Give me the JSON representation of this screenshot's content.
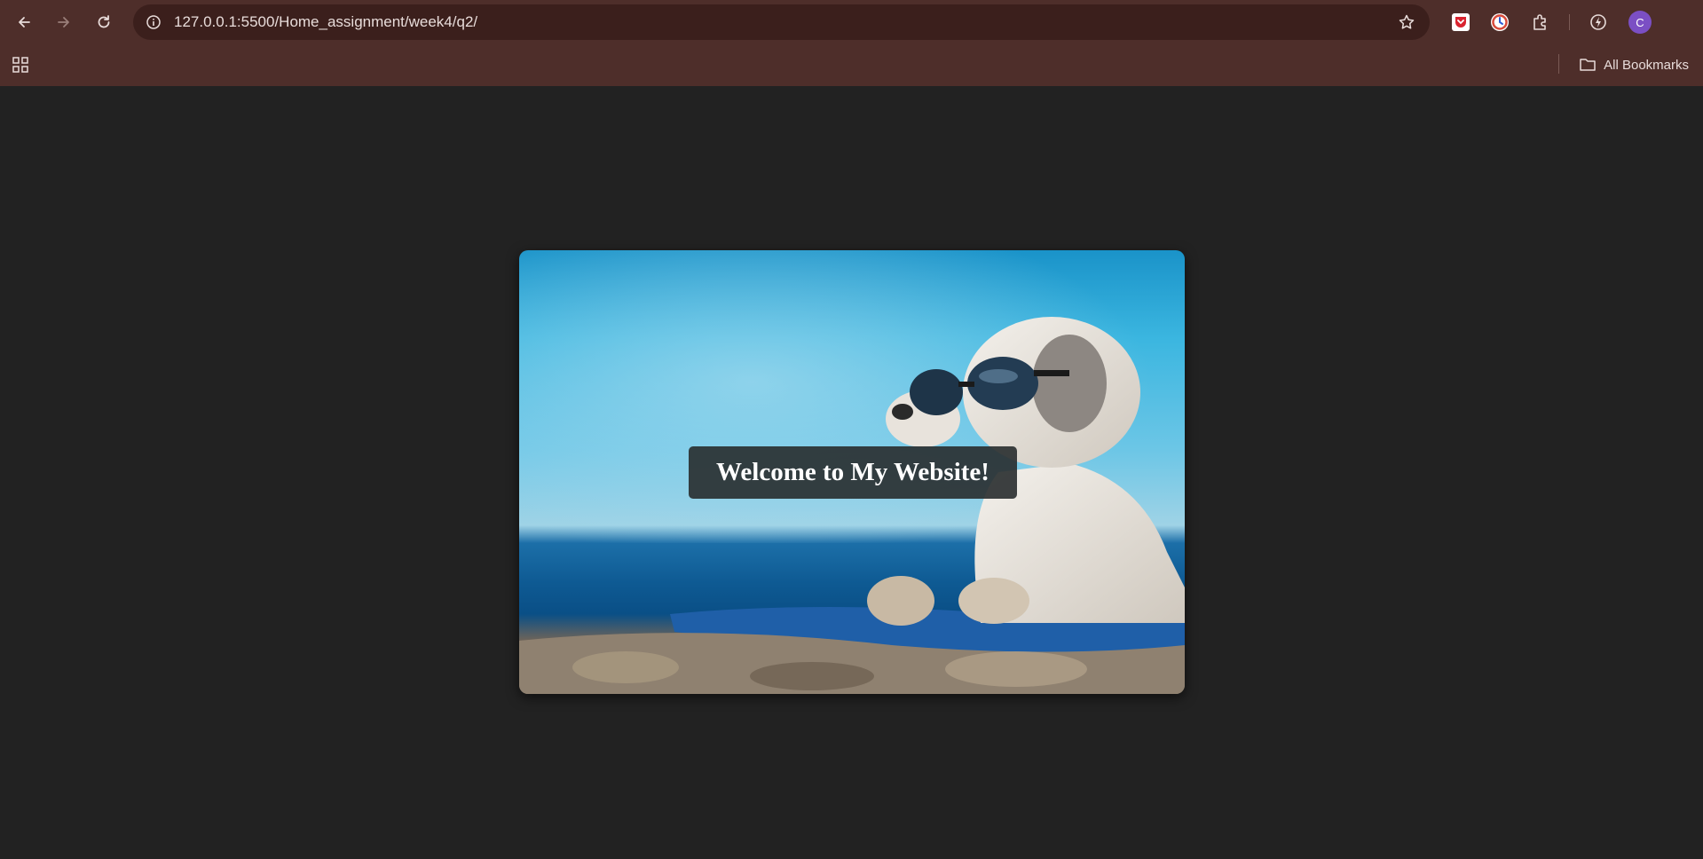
{
  "browser": {
    "url": "127.0.0.1:5500/Home_assignment/week4/q2/",
    "profile_initial": "C",
    "bookmarks_label": "All Bookmarks",
    "icons": {
      "back": "arrow-left-icon",
      "forward": "arrow-right-icon",
      "reload": "reload-icon",
      "site_info": "info-icon",
      "bookmark_star": "star-icon",
      "extensions": [
        "pocket-icon",
        "clock-icon",
        "puzzle-icon",
        "bolt-icon"
      ],
      "apps": "apps-grid-icon",
      "folder": "folder-icon"
    },
    "colors": {
      "toolbar": "#4e2e2a",
      "omnibox": "#3b1f1c",
      "avatar": "#7b4fc4"
    }
  },
  "page": {
    "background": "#222222",
    "hero": {
      "heading": "Welcome to My Website!",
      "image_alt": "dog-with-sunglasses-on-beach"
    }
  }
}
